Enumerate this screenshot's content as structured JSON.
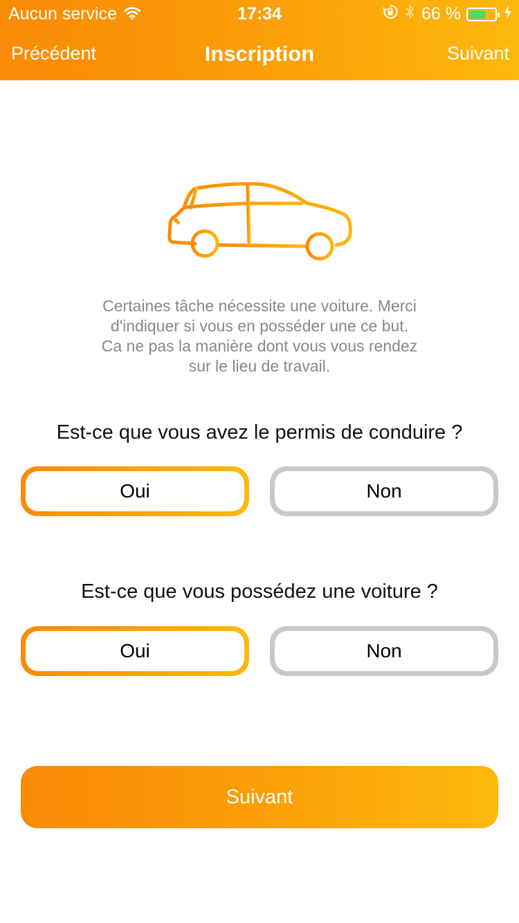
{
  "status_bar": {
    "carrier": "Aucun service",
    "time": "17:34",
    "battery_percent": "66 %",
    "battery_level": 0.66,
    "icons": [
      "wifi-icon",
      "rotation-lock-icon",
      "bluetooth-icon",
      "battery-icon",
      "charging-icon"
    ]
  },
  "nav": {
    "back_label": "Précédent",
    "title": "Inscription",
    "next_label": "Suivant"
  },
  "illustration": {
    "icon": "car-icon"
  },
  "intro": {
    "lines": [
      "Certaines tâche nécessite une voiture. Merci",
      "d'indiquer si vous en posséder une ce but.",
      "Ca ne pas la manière dont vous vous rendez",
      "sur le lieu de travail."
    ]
  },
  "questions": [
    {
      "text": "Est-ce que vous avez le permis de conduire ?",
      "options": [
        "Oui",
        "Non"
      ],
      "selected": "Oui"
    },
    {
      "text": "Est-ce que vous possédez une voiture ?",
      "options": [
        "Oui",
        "Non"
      ],
      "selected": "Oui"
    }
  ],
  "submit": {
    "label": "Suivant"
  },
  "colors": {
    "accent_start": "#f98a06",
    "accent_end": "#fcb80c",
    "unselected_border": "#c9c9c9",
    "intro_text": "#888888",
    "battery_fill": "#4cd964"
  }
}
